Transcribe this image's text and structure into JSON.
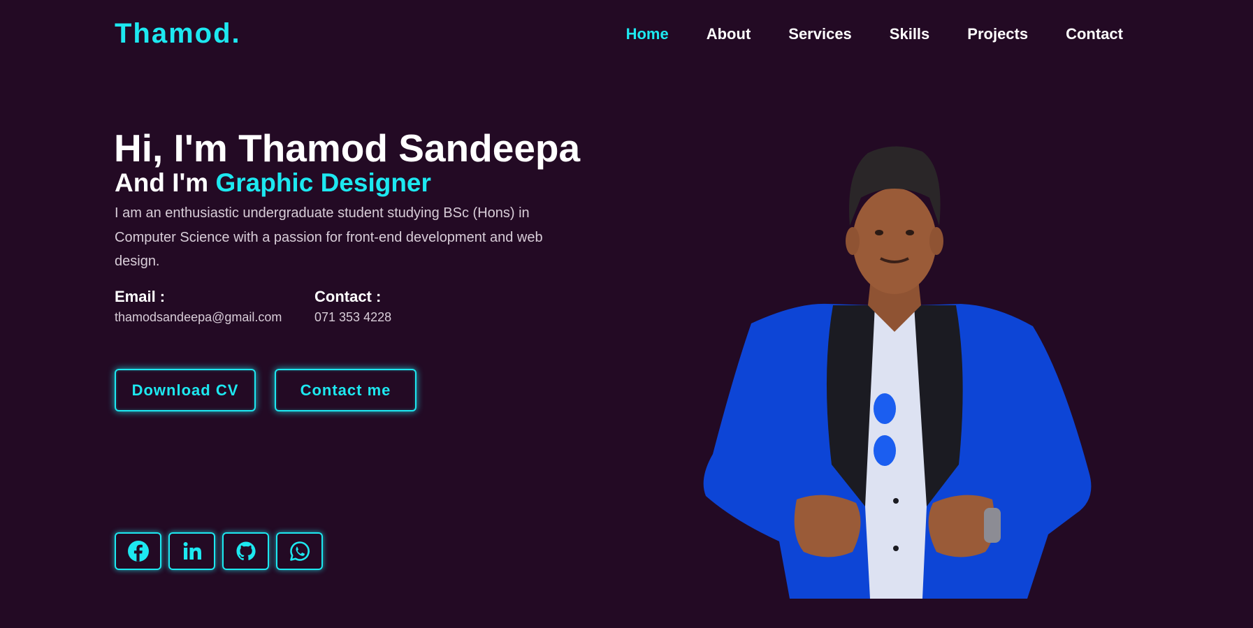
{
  "brand": {
    "logo": "Thamod."
  },
  "nav": {
    "items": [
      {
        "label": "Home",
        "active": true
      },
      {
        "label": "About"
      },
      {
        "label": "Services"
      },
      {
        "label": "Skills"
      },
      {
        "label": "Projects"
      },
      {
        "label": "Contact"
      }
    ]
  },
  "hero": {
    "title": "Hi, I'm Thamod Sandeepa",
    "subtitle_prefix": "And I'm ",
    "subtitle_role": "Graphic Designer",
    "description": "I am an enthusiastic undergraduate student studying BSc (Hons) in Computer Science with a passion for front-end development and web design."
  },
  "info": {
    "email_label": "Email :",
    "email_value": "thamodsandeepa@gmail.com",
    "contact_label": "Contact :",
    "contact_value": "071 353 4228"
  },
  "buttons": {
    "download_cv": "Download CV",
    "contact_me": "Contact me"
  },
  "socials": [
    "facebook-icon",
    "linkedin-icon",
    "github-icon",
    "whatsapp-icon"
  ],
  "colors": {
    "background": "#230a24",
    "accent": "#1de8f0",
    "text": "#ffffff",
    "muted_text": "#d8cdd8"
  }
}
